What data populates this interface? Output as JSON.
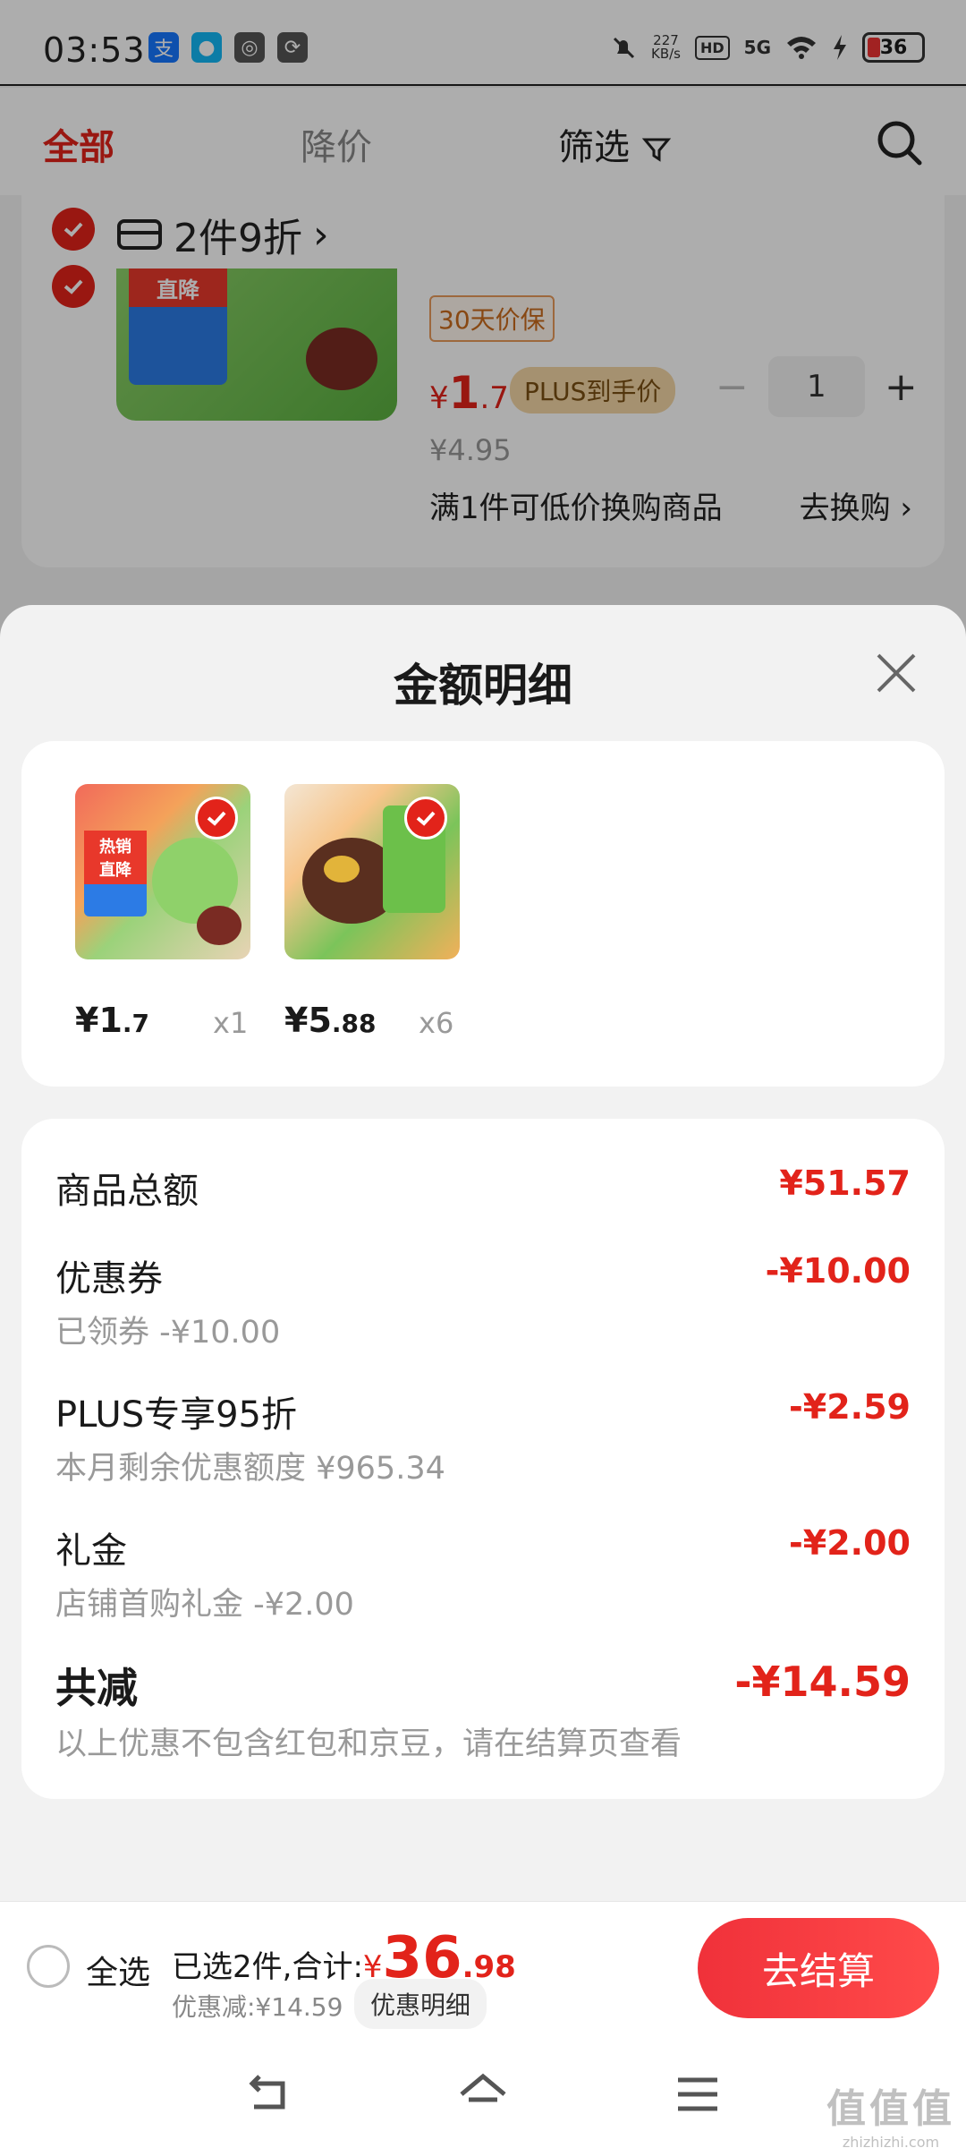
{
  "status_bar": {
    "time": "03:53",
    "speed_value": "227",
    "speed_unit": "KB/s",
    "hd": "HD",
    "network": "5G",
    "battery": "36"
  },
  "nav_tabs": {
    "all": "全部",
    "price_drop": "降价",
    "filter": "筛选"
  },
  "cart_item": {
    "promo": "2件9折",
    "price_guarantee": "30天价保",
    "price_symbol": "¥",
    "price_int": "1",
    "price_dec": ".7",
    "plus_label": "PLUS到手价",
    "qty": "1",
    "original_price": "¥4.95",
    "swap_text": "满1件可低价换购商品",
    "swap_button": "去换购"
  },
  "sheet": {
    "title": "金额明细",
    "goods": [
      {
        "price_int": "¥1",
        "price_dec": ".7",
        "qty": "x1"
      },
      {
        "price_int": "¥5",
        "price_dec": ".88",
        "qty": "x6"
      }
    ],
    "rows": {
      "total_label": "商品总额",
      "total_value": "¥51.57",
      "coupon_label": "优惠券",
      "coupon_sub": "已领券 -¥10.00",
      "coupon_value": "-¥10.00",
      "plus_label": "PLUS专享95折",
      "plus_sub": "本月剩余优惠额度 ¥965.34",
      "plus_value": "-¥2.59",
      "gift_label": "礼金",
      "gift_sub": "店铺首购礼金 -¥2.00",
      "gift_value": "-¥2.00",
      "sum_label": "共减",
      "sum_sub": "以上优惠不包含红包和京豆，请在结算页查看",
      "sum_value": "-¥14.59"
    }
  },
  "bottom_bar": {
    "select_all": "全选",
    "selected_text": "已选2件,合计:",
    "currency": "¥",
    "total_int": "36",
    "total_dec": ".98",
    "discount_text": "优惠减:¥14.59",
    "detail_button": "优惠明细",
    "checkout_button": "去结算"
  },
  "watermark": {
    "main": "值值值",
    "sub": "zhizhizhi.com"
  },
  "colors": {
    "accent_red": "#e2231a",
    "sheet_bg": "#f2f2f2"
  }
}
